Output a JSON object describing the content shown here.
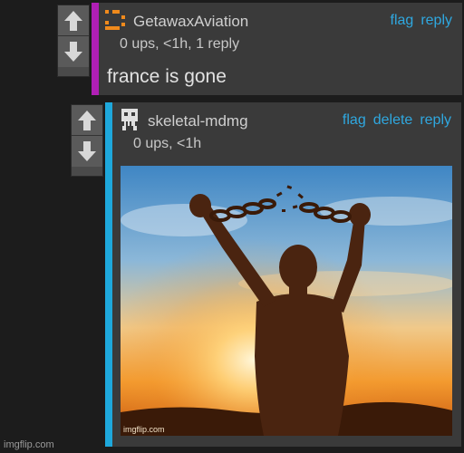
{
  "comments": [
    {
      "username": "GetawaxAviation",
      "meta": "0 ups, <1h, 1 reply",
      "actions": [
        "flag",
        "reply"
      ],
      "body": "france is gone",
      "accent_color": "#b01fb5",
      "avatar_icon": "orange-pixel-avatar-icon"
    },
    {
      "username": "skeletal-mdmg",
      "meta": "0 ups, <1h",
      "actions": [
        "flag",
        "delete",
        "reply"
      ],
      "accent_color": "#1ea8dc",
      "avatar_icon": "skull-pixel-avatar-icon",
      "image": {
        "description": "silhouette breaking chains at sunset",
        "watermark": "imgflip.com"
      }
    }
  ],
  "site_watermark": "imgflip.com"
}
